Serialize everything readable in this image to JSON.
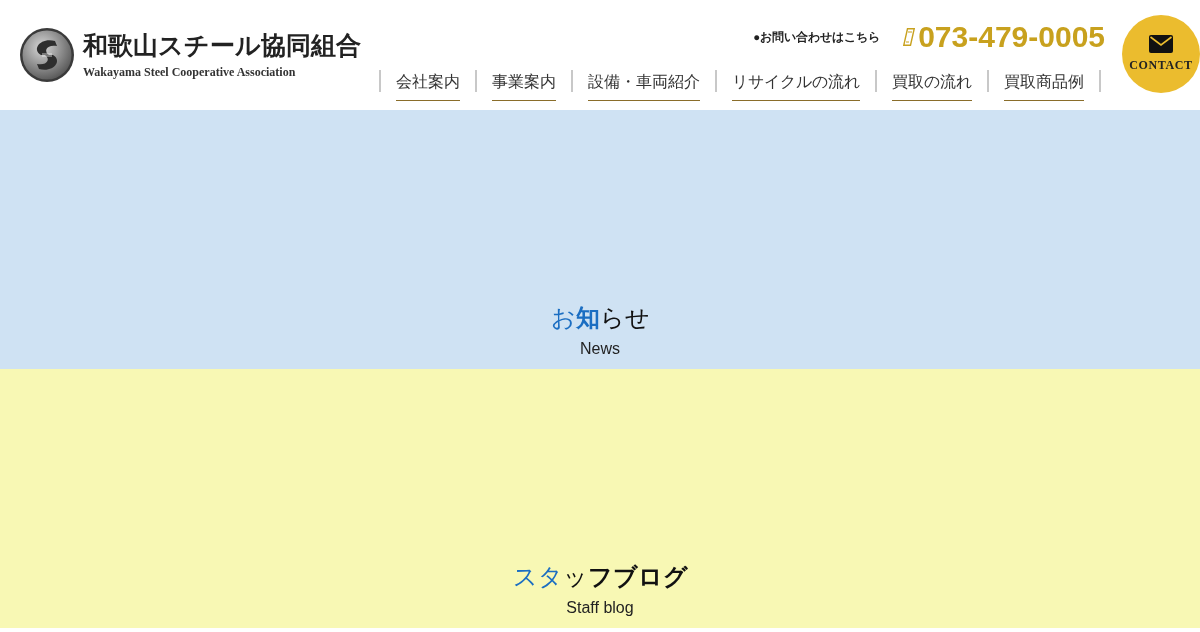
{
  "header": {
    "logo": {
      "title": "和歌山スチール協同組合",
      "subtitle": "Wakayama Steel Cooperative Association"
    },
    "contact": {
      "label": "●お問い合わせはこちら",
      "phone": "073-479-0005",
      "button": "CONTACT"
    },
    "nav": [
      "会社案内",
      "事業案内",
      "設備・車両紹介",
      "リサイクルの流れ",
      "買取の流れ",
      "買取商品例"
    ]
  },
  "sections": [
    {
      "kind": "news",
      "title_accent": "お**知**",
      "title_rest": "らせ",
      "subtitle": "News"
    },
    {
      "kind": "blog",
      "title_accent": "スタ",
      "title_rest": "ッ**フブログ**",
      "subtitle": "Staff blog"
    }
  ]
}
